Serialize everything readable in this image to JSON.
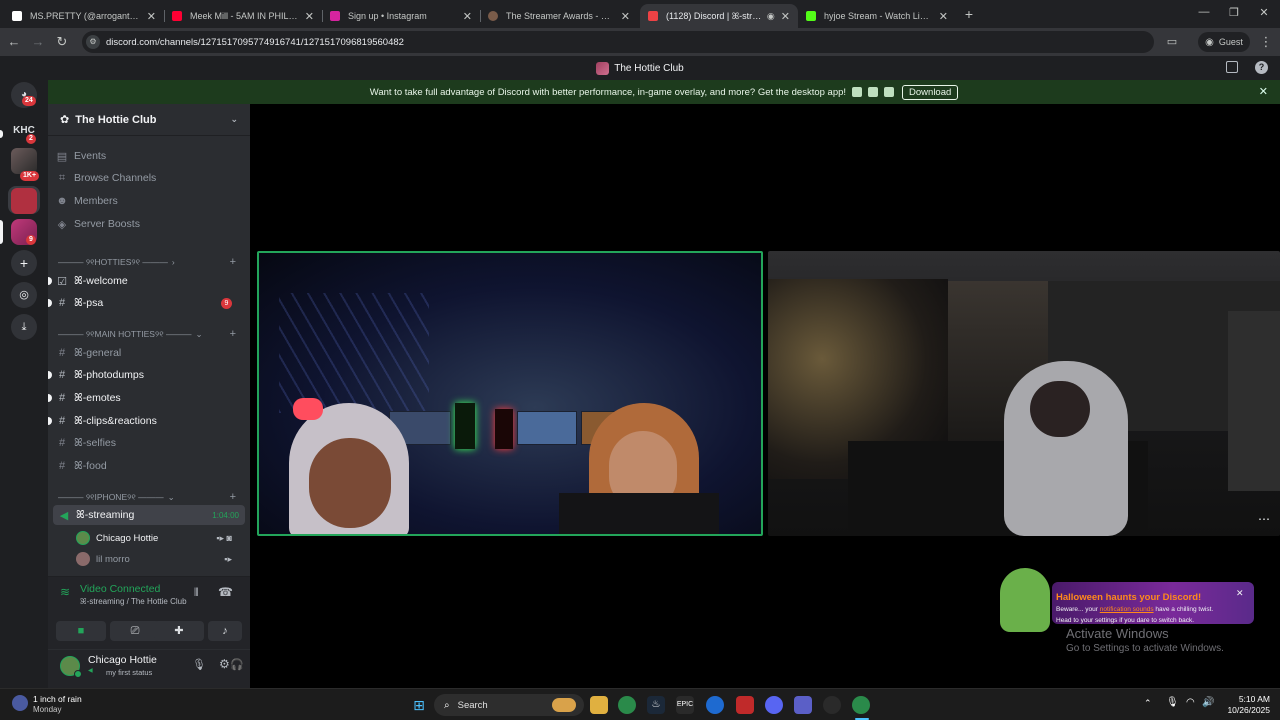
{
  "browser": {
    "tabs": [
      {
        "title": "MS.PRETTY (@arrogantdoll) | TikTok",
        "icon": "tiktok-icon",
        "color": "#ffffff"
      },
      {
        "title": "Meek Mill - 5AM IN PHILLY (Official Video)",
        "icon": "youtube-icon",
        "color": "#ff0033"
      },
      {
        "title": "Sign up • Instagram",
        "icon": "instagram-icon",
        "color": "#d6249f"
      },
      {
        "title": "The Streamer Awards - Nominations",
        "icon": "streamer-awards-icon",
        "color": "#7a5c4a"
      },
      {
        "title": "(1128) Discord | ꕤ-streaming",
        "icon": "discord-icon",
        "color": "#ed4245"
      },
      {
        "title": "hyjoe Stream - Watch Live on Kick",
        "icon": "kick-icon",
        "color": "#53fc18"
      }
    ],
    "url": "discord.com/channels/1271517095774916741/1271517096819560482",
    "profile_label": "Guest"
  },
  "discord": {
    "window_title": "The Hottie Club",
    "banner": {
      "text": "Want to take full advantage of Discord with better performance, in-game overlay, and more? Get the desktop app!",
      "download_label": "Download"
    },
    "server_rail": {
      "dm_badge": "24",
      "folder_label": "KHC",
      "folder_badge": "2",
      "server_badge_1": "1K+",
      "server_badge_2": "9"
    },
    "server_name": "The Hottie Club",
    "nav_items": [
      {
        "label": "Events",
        "icon": "calendar-icon"
      },
      {
        "label": "Browse Channels",
        "icon": "browse-channels-icon"
      },
      {
        "label": "Members",
        "icon": "members-icon"
      },
      {
        "label": "Server Boosts",
        "icon": "boost-icon"
      }
    ],
    "categories": {
      "hotties": "——— ୨୧HOTTIES୨୧ ———",
      "main": "——— ୨୧MAIN HOTTIES୨୧ ———",
      "iphone": "——— ୨୧IPHONE୨୧ ———"
    },
    "channels": {
      "welcome": "ꕤ-welcome",
      "psa": "ꕤ-psa",
      "psa_badge": "9",
      "general": "ꕤ-general",
      "photodumps": "ꕤ-photodumps",
      "emotes": "ꕤ-emotes",
      "clips": "ꕤ-clips&reactions",
      "selfies": "ꕤ-selfies",
      "food": "ꕤ-food",
      "streaming": "ꕤ-streaming",
      "streaming_timer": "1:04:00"
    },
    "voice_users": [
      "Chicago Hottie",
      "lil morro"
    ],
    "voice_panel": {
      "status": "Video Connected",
      "location": "ꕤ-streaming / The Hottie Club"
    },
    "user_panel": {
      "name": "Chicago Hottie",
      "status": "my first status"
    },
    "toast": {
      "title": "Halloween haunts your Discord!",
      "line1_prefix": "Beware... your",
      "line1_link": "notification sounds",
      "line1_suffix": "have a chilling twist.",
      "line2": "Head to your settings if you dare to switch back."
    },
    "watermark": {
      "title": "Activate Windows",
      "subtitle": "Go to Settings to activate Windows."
    }
  },
  "taskbar": {
    "weather_title": "1 inch of rain",
    "weather_sub": "Monday",
    "search_label": "Search",
    "time": "5:10 AM",
    "date": "10/26/2025"
  }
}
